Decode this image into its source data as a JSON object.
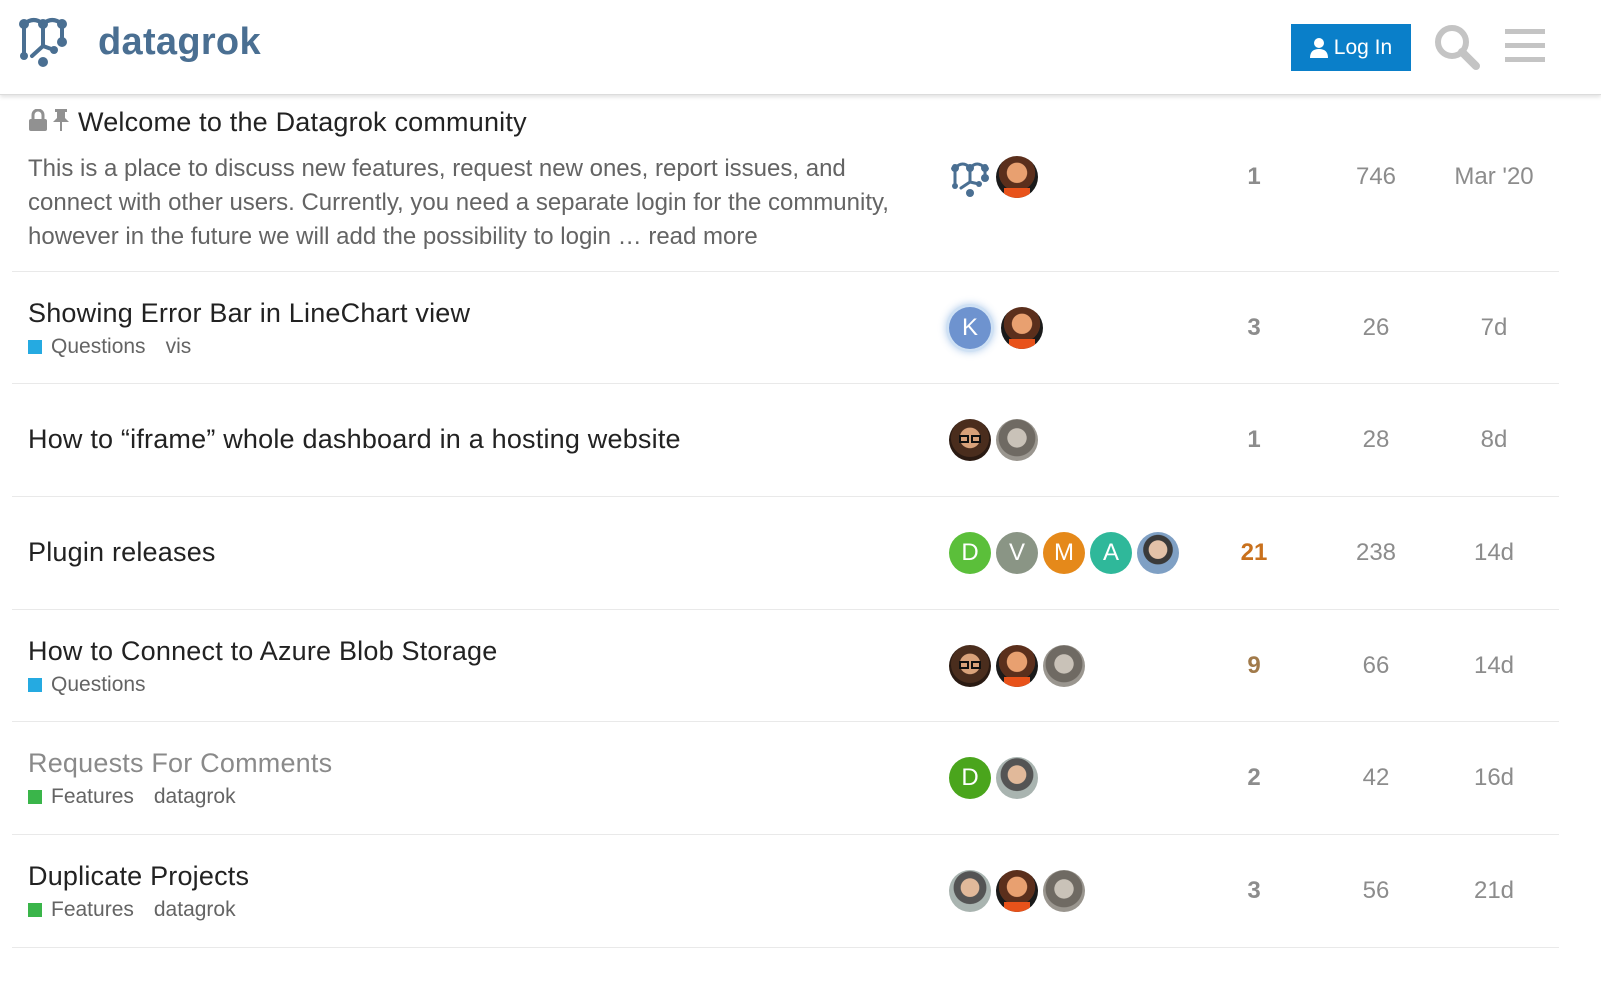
{
  "site": {
    "name": "datagrok"
  },
  "header": {
    "login_label": "Log In"
  },
  "icons": {
    "logo": "datagrok-logo-icon",
    "user": "user-icon",
    "search": "search-icon",
    "menu": "hamburger-menu-icon",
    "lock": "lock-icon",
    "pin": "pin-icon"
  },
  "colors": {
    "brand": "#4a6f92",
    "login_button": "#0a7fc9",
    "category_questions": "#25aae1",
    "category_features": "#3ab54a",
    "hot_replies": "#c9711d"
  },
  "topics": [
    {
      "title": "Welcome to the Datagrok community",
      "excerpt": "This is a place to discuss new features, request new ones, report issues, and connect with other users. Currently, you need a separate login for the community, however in the future we will add the possibility to login …",
      "read_more": "read more",
      "replies": "1",
      "views": "746",
      "activity": "Mar '20"
    },
    {
      "title": "Showing Error Bar in LineChart view",
      "category": "Questions",
      "tags": [
        "vis"
      ],
      "avatars": [
        "K"
      ],
      "replies": "3",
      "views": "26",
      "activity": "7d"
    },
    {
      "title": "How to “iframe” whole dashboard in a hosting website",
      "replies": "1",
      "views": "28",
      "activity": "8d"
    },
    {
      "title": "Plugin releases",
      "avatars": [
        "D",
        "V",
        "M",
        "A"
      ],
      "replies": "21",
      "views": "238",
      "activity": "14d"
    },
    {
      "title": "How to Connect to Azure Blob Storage",
      "category": "Questions",
      "replies": "9",
      "views": "66",
      "activity": "14d"
    },
    {
      "title": "Requests For Comments",
      "category": "Features",
      "tags": [
        "datagrok"
      ],
      "avatars": [
        "D"
      ],
      "replies": "2",
      "views": "42",
      "activity": "16d"
    },
    {
      "title": "Duplicate Projects",
      "category": "Features",
      "tags": [
        "datagrok"
      ],
      "replies": "3",
      "views": "56",
      "activity": "21d"
    }
  ]
}
